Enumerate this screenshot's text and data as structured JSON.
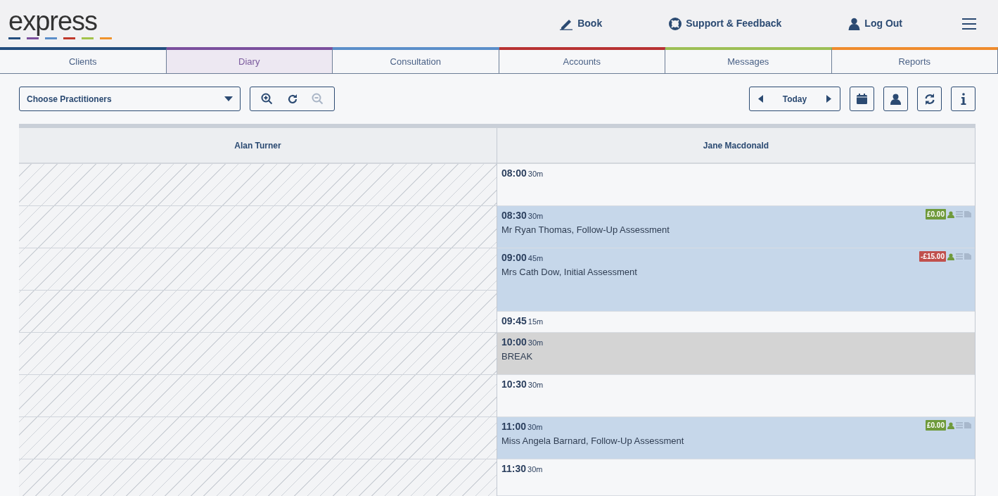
{
  "header": {
    "logo": "express",
    "actions": [
      {
        "kind": "book",
        "label": "Book"
      },
      {
        "kind": "support",
        "label": "Support & Feedback"
      },
      {
        "kind": "logout",
        "label": "Log Out"
      }
    ]
  },
  "tabs": [
    {
      "label": "Clients",
      "color": "#234d7e",
      "selected": false
    },
    {
      "label": "Diary",
      "color": "#7b4f9d",
      "selected": true
    },
    {
      "label": "Consultation",
      "color": "#5b8ec9",
      "selected": false
    },
    {
      "label": "Accounts",
      "color": "#b83232",
      "selected": false
    },
    {
      "label": "Messages",
      "color": "#9dbf55",
      "selected": false
    },
    {
      "label": "Reports",
      "color": "#ef8b2c",
      "selected": false
    }
  ],
  "toolbar": {
    "practitioners": {
      "placeholder": "Choose Practitioners"
    },
    "zoom_out_disabled": true,
    "today": "Today"
  },
  "diary": {
    "columns": [
      "Alan Turner",
      "Jane Macdonald"
    ],
    "slots": [
      {
        "kind": "free",
        "time": "08:00",
        "duration": "30m"
      },
      {
        "kind": "appointment",
        "time": "08:30",
        "duration": "30m",
        "client": "Mr Ryan Thomas, Follow-Up Assessment",
        "balance": "£0.00",
        "color": "#6f9a3b"
      },
      {
        "kind": "appointment",
        "time": "09:00",
        "duration": "45m",
        "client": "Mrs Cath Dow, Initial Assessment",
        "balance": "-£15.00",
        "color": "#c0504d"
      },
      {
        "kind": "free",
        "time": "09:45",
        "duration": "15m"
      },
      {
        "kind": "break",
        "time": "10:00",
        "duration": "30m",
        "client": "BREAK"
      },
      {
        "kind": "free",
        "time": "10:30",
        "duration": "30m"
      },
      {
        "kind": "appointment",
        "time": "11:00",
        "duration": "30m",
        "client": "Miss Angela Barnard, Follow-Up Assessment",
        "balance": "£0.00",
        "color": "#6f9a3b"
      },
      {
        "kind": "free",
        "time": "11:30",
        "duration": "30m"
      }
    ]
  }
}
